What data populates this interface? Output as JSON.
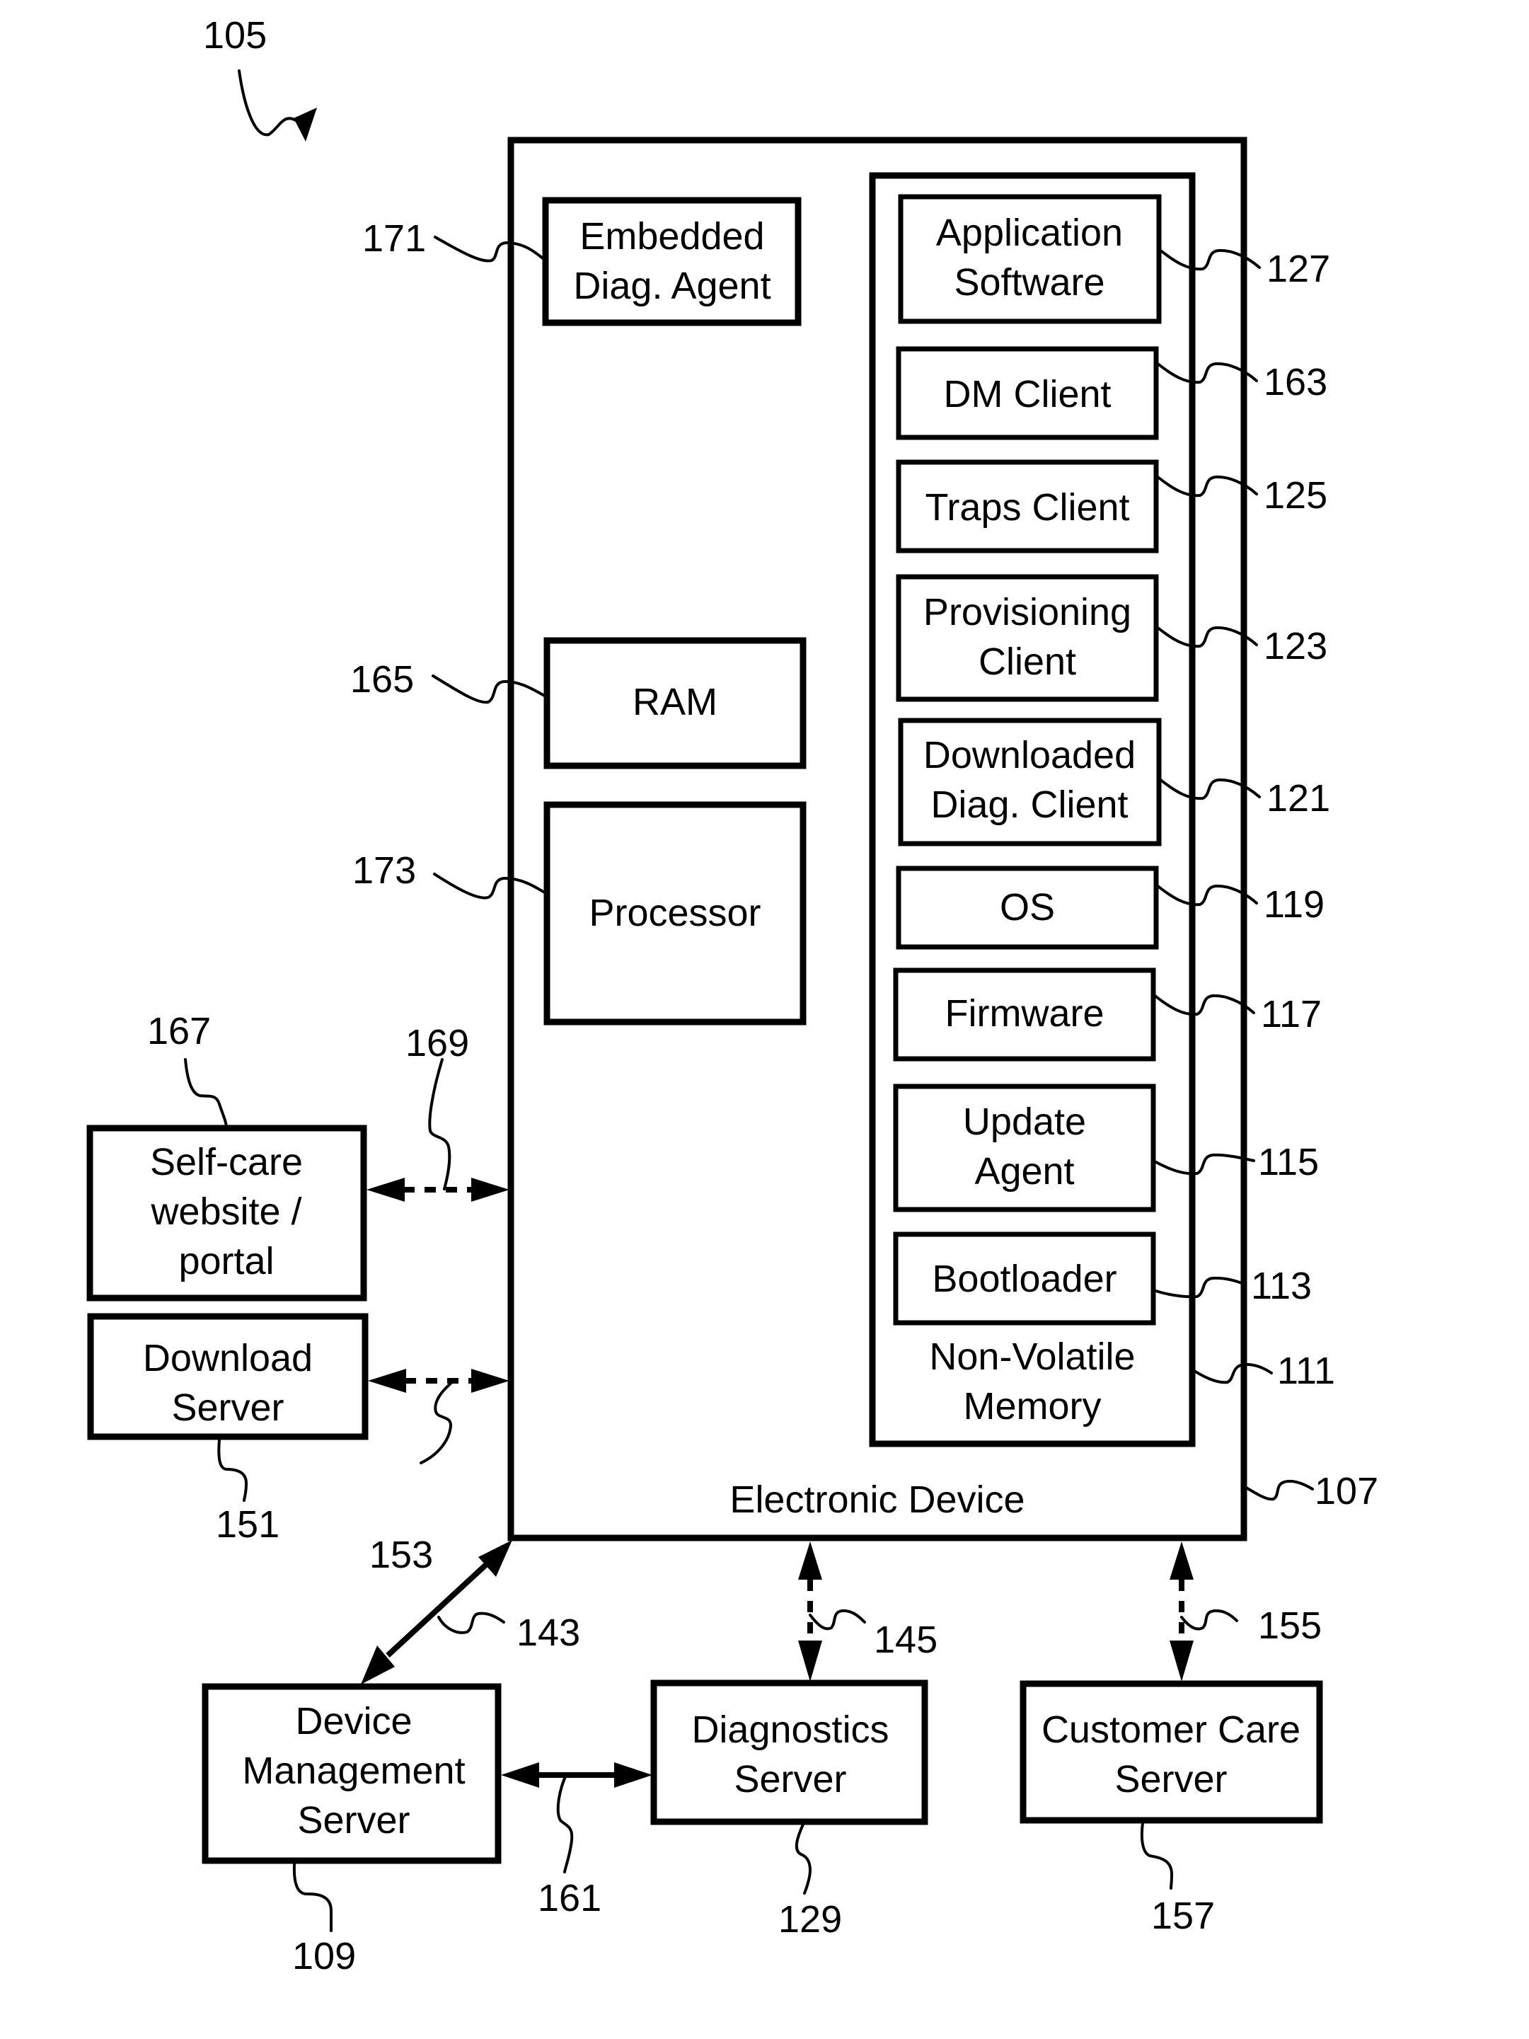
{
  "figure_ref": "105",
  "device": {
    "label": "Electronic Device",
    "ref": "107"
  },
  "device_components": [
    {
      "key": "embedded_diag_agent",
      "lines": [
        "Embedded",
        "Diag. Agent"
      ],
      "ref": "171"
    },
    {
      "key": "ram",
      "lines": [
        "RAM"
      ],
      "ref": "165"
    },
    {
      "key": "processor",
      "lines": [
        "Processor"
      ],
      "ref": "173"
    }
  ],
  "nvm": {
    "lines": [
      "Non-Volatile",
      "Memory"
    ],
    "ref": "111",
    "items": [
      {
        "key": "application_software",
        "lines": [
          "Application",
          "Software"
        ],
        "ref": "127"
      },
      {
        "key": "dm_client",
        "lines": [
          "DM Client"
        ],
        "ref": "163"
      },
      {
        "key": "traps_client",
        "lines": [
          "Traps Client"
        ],
        "ref": "125"
      },
      {
        "key": "provisioning_client",
        "lines": [
          "Provisioning",
          "Client"
        ],
        "ref": "123"
      },
      {
        "key": "downloaded_diag_client",
        "lines": [
          "Downloaded",
          "Diag. Client"
        ],
        "ref": "121"
      },
      {
        "key": "os",
        "lines": [
          "OS"
        ],
        "ref": "119"
      },
      {
        "key": "firmware",
        "lines": [
          "Firmware"
        ],
        "ref": "117"
      },
      {
        "key": "update_agent",
        "lines": [
          "Update",
          "Agent"
        ],
        "ref": "115"
      },
      {
        "key": "bootloader",
        "lines": [
          "Bootloader"
        ],
        "ref": "113"
      }
    ]
  },
  "external": [
    {
      "key": "self_care_portal",
      "lines": [
        "Self-care",
        "website /",
        "portal"
      ],
      "ref": "167"
    },
    {
      "key": "download_server",
      "lines": [
        "Download",
        "Server"
      ],
      "ref": "151"
    },
    {
      "key": "device_management_server",
      "lines": [
        "Device",
        "Management",
        "Server"
      ],
      "ref": "109"
    },
    {
      "key": "diagnostics_server",
      "lines": [
        "Diagnostics",
        "Server"
      ],
      "ref": "129"
    },
    {
      "key": "customer_care_server",
      "lines": [
        "Customer Care",
        "Server"
      ],
      "ref": "157"
    }
  ],
  "links": [
    {
      "key": "selfcare_device",
      "ref": "169",
      "style": "dashed"
    },
    {
      "key": "download_device",
      "ref": "153",
      "style": "dashed"
    },
    {
      "key": "dms_device",
      "ref": "143",
      "style": "solid"
    },
    {
      "key": "diag_device",
      "ref": "145",
      "style": "dashed"
    },
    {
      "key": "ccs_device",
      "ref": "155",
      "style": "dashed"
    },
    {
      "key": "dms_diag",
      "ref": "161",
      "style": "solid"
    }
  ]
}
